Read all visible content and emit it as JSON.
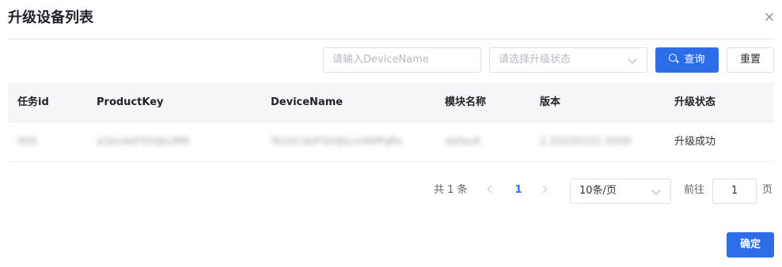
{
  "dialog": {
    "title": "升级设备列表",
    "close_icon": "close-icon ×"
  },
  "filters": {
    "device_name_placeholder": "请输入DeviceName",
    "status_placeholder": "请选择升级状态",
    "query_label": "查询",
    "reset_label": "重置"
  },
  "table": {
    "columns": [
      "任务id",
      "ProductKey",
      "DeviceName",
      "模块名称",
      "版本",
      "升级状态"
    ],
    "rows": [
      [
        "000",
        "a1bcdeFGhIJkLMN",
        "Te1bCdeFGhIJkLmN0PqRs",
        "default",
        "2.20220101.0000",
        "升级成功"
      ]
    ]
  },
  "pagination": {
    "total_text": "共 1 条",
    "current_page": "1",
    "page_size": "10条/页",
    "goto_label": "前往",
    "goto_value": "1",
    "page_unit": "页"
  },
  "footer": {
    "confirm_label": "确定"
  },
  "colors": {
    "primary": "#2d6ee8",
    "header_bg": "#f5f6f8",
    "border": "#dcdfe6"
  }
}
